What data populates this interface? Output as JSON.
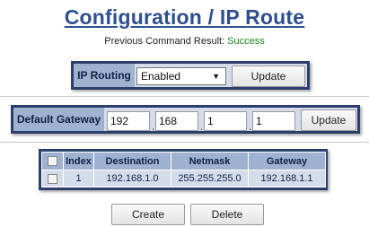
{
  "page": {
    "title": "Configuration / IP Route",
    "result_label": "Previous Command Result: ",
    "result_value": "Success"
  },
  "ip_routing": {
    "label": "IP Routing",
    "selected": "Enabled",
    "update_label": "Update"
  },
  "default_gateway": {
    "label": "Default Gateway",
    "octets": [
      "192",
      "168",
      "1",
      "1"
    ],
    "update_label": "Update"
  },
  "routes_table": {
    "columns": [
      "Index",
      "Destination",
      "Netmask",
      "Gateway"
    ],
    "rows": [
      {
        "index": "1",
        "destination": "192.168.1.0",
        "netmask": "255.255.255.0",
        "gateway": "192.168.1.1"
      }
    ]
  },
  "actions": {
    "create_label": "Create",
    "delete_label": "Delete"
  },
  "colors": {
    "title": "#2f4f8f",
    "success": "#1a8a1a",
    "panel_border": "#2b3f6a",
    "header_bg": "#9fb2cf",
    "cell_bg": "#d4dcea"
  }
}
